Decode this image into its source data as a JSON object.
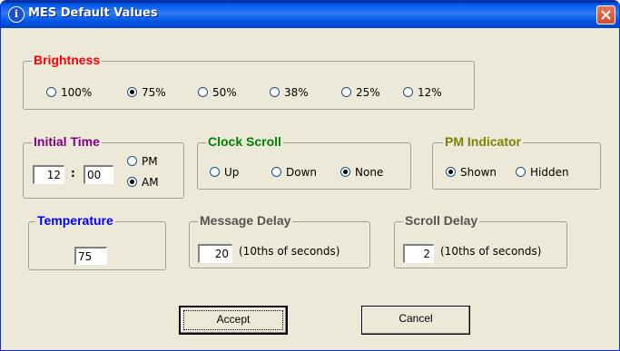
{
  "window": {
    "title": "MES Default Values",
    "close_glyph": "✕"
  },
  "colors": {
    "brightness": "#FF0000",
    "initial_time": "#800080",
    "clock_scroll": "#008000",
    "pm_indicator": "#808000",
    "temperature": "#0000FF",
    "delay": "#555555"
  },
  "brightness": {
    "label": "Brightness",
    "options": [
      "100%",
      "75%",
      "50%",
      "38%",
      "25%",
      "12%"
    ],
    "selected": "75%"
  },
  "initial_time": {
    "label": "Initial Time",
    "hour": "12",
    "separator": ":",
    "minute": "00",
    "pm_label": "PM",
    "am_label": "AM",
    "selected": "AM"
  },
  "clock_scroll": {
    "label": "Clock Scroll",
    "options": [
      "Up",
      "Down",
      "None"
    ],
    "selected": "None"
  },
  "pm_indicator": {
    "label": "PM Indicator",
    "options": [
      "Shown",
      "Hidden"
    ],
    "selected": "Shown"
  },
  "temperature": {
    "label": "Temperature",
    "value": "75"
  },
  "message_delay": {
    "label": "Message Delay",
    "value": "20",
    "unit": "(10ths of seconds)"
  },
  "scroll_delay": {
    "label": "Scroll Delay",
    "value": "2",
    "unit": "(10ths of seconds)"
  },
  "buttons": {
    "accept": "Accept",
    "cancel": "Cancel"
  }
}
